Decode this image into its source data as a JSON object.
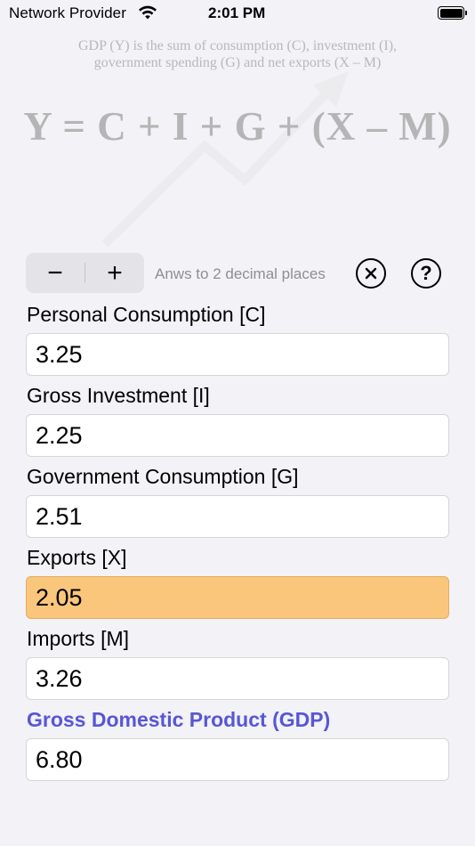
{
  "status_bar": {
    "carrier": "Network Provider",
    "time": "2:01 PM"
  },
  "illustration": {
    "caption_line1": "GDP (Y) is the sum of consumption (C), investment (I),",
    "caption_line2": "government spending (G) and net exports (X – M)",
    "equation": "Y = C + I + G + (X – M)"
  },
  "toolbar": {
    "minus_label": "−",
    "plus_label": "+",
    "hint": "Anws to 2 decimal places",
    "help_label": "?"
  },
  "fields": [
    {
      "label": "Personal Consumption [C]",
      "value": "3.25"
    },
    {
      "label": "Gross Investment [I]",
      "value": "2.25"
    },
    {
      "label": "Government Consumption [G]",
      "value": "2.51"
    },
    {
      "label": "Exports [X]",
      "value": "2.05",
      "focused": true
    },
    {
      "label": "Imports [M]",
      "value": "3.26"
    }
  ],
  "result": {
    "label": "Gross Domestic Product (GDP)",
    "value": "6.80"
  },
  "colors": {
    "result_label": "#5856d6",
    "focused_field": "#f9c67c"
  }
}
